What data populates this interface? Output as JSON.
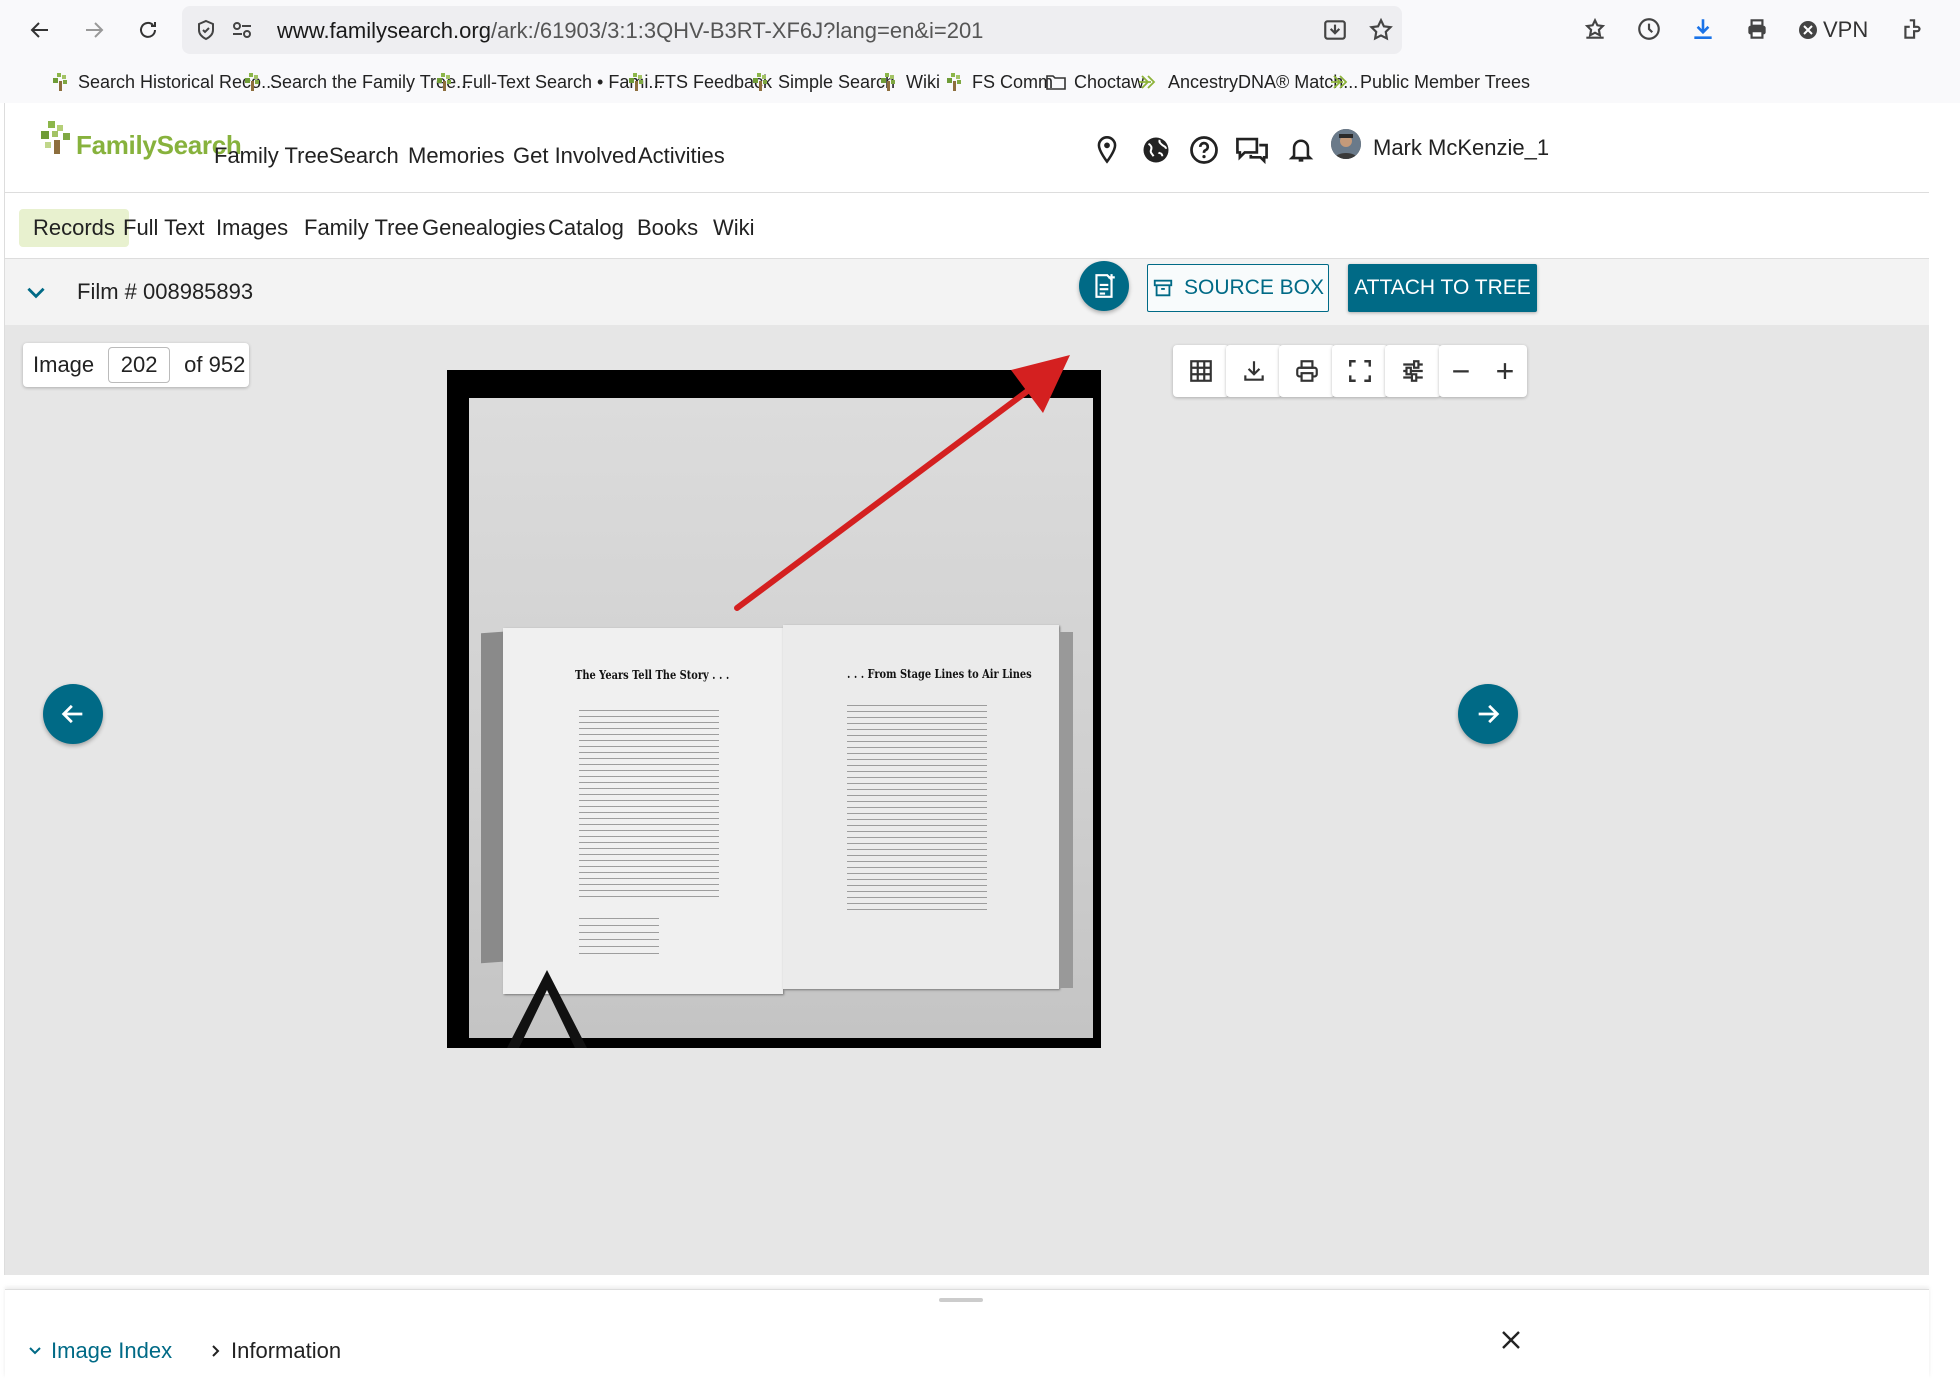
{
  "browser": {
    "url_domain": "www.familysearch.org",
    "url_path": "/ark:/61903/3:1:3QHV-B3RT-XF6J?lang=en&i=201",
    "vpn_label": "VPN",
    "bookmarks": [
      {
        "label": "Search Historical Reco...",
        "icon": "familysearch-tree-icon"
      },
      {
        "label": "Search the Family Tree...",
        "icon": "familysearch-tree-icon"
      },
      {
        "label": "Full-Text Search • Fami...",
        "icon": "familysearch-tree-icon"
      },
      {
        "label": "FTS Feedback",
        "icon": "familysearch-tree-icon"
      },
      {
        "label": "Simple Search",
        "icon": "familysearch-tree-icon"
      },
      {
        "label": "Wiki",
        "icon": "familysearch-tree-icon"
      },
      {
        "label": "FS Comm",
        "icon": "familysearch-tree-icon"
      },
      {
        "label": "Choctaw",
        "icon": "folder-icon"
      },
      {
        "label": "AncestryDNA® Match...",
        "icon": "ancestry-leaf-icon"
      },
      {
        "label": "Public Member Trees",
        "icon": "ancestry-leaf-icon"
      }
    ]
  },
  "header": {
    "logo_text": "FamilySearch",
    "nav": [
      "Family Tree",
      "Search",
      "Memories",
      "Get Involved",
      "Activities"
    ],
    "user_name": "Mark McKenzie_1"
  },
  "subnav": {
    "tabs": [
      "Records",
      "Full Text",
      "Images",
      "Family Tree",
      "Genealogies",
      "Catalog",
      "Books",
      "Wiki"
    ],
    "active": "Records"
  },
  "filmbar": {
    "film_label": "Film # 008985893",
    "source_box_label": "SOURCE BOX",
    "attach_label": "ATTACH TO TREE"
  },
  "viewer": {
    "image_label": "Image",
    "image_number": "202",
    "image_total": "of 952",
    "zoom_out": "−",
    "zoom_in": "+"
  },
  "document": {
    "left_title": "The Years Tell The Story . . .",
    "right_title": ". . . From Stage Lines to Air Lines"
  },
  "bottom": {
    "image_index_label": "Image Index",
    "information_label": "Information"
  },
  "colors": {
    "brand_teal": "#006a86",
    "brand_green": "#87b23d",
    "active_tab_bg": "#e8f1cf",
    "annotation_arrow": "#d42020"
  }
}
